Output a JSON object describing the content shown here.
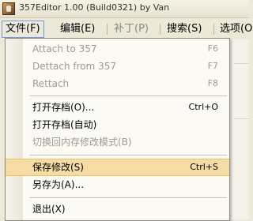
{
  "window": {
    "title": "357Editor 1.00 (Build0321) by Van"
  },
  "menubar": {
    "items": [
      {
        "label": "文件(F)",
        "state": "active"
      },
      {
        "label": "编辑(E)",
        "state": "normal"
      },
      {
        "label": "补丁(P)",
        "state": "disabled"
      },
      {
        "label": "搜索(S)",
        "state": "normal"
      },
      {
        "label": "选项(O)",
        "state": "normal"
      }
    ]
  },
  "file_menu": {
    "items": [
      {
        "label": "Attach to 357",
        "shortcut": "F6",
        "enabled": false
      },
      {
        "label": "Dettach from 357",
        "shortcut": "F7",
        "enabled": false
      },
      {
        "label": "Rettach",
        "shortcut": "F8",
        "enabled": false
      },
      {
        "label": "打开存档(O)...",
        "shortcut": "Ctrl+O",
        "enabled": true
      },
      {
        "label": "打开存档(自动)",
        "shortcut": "",
        "enabled": true
      },
      {
        "label": "切换回内存修改模式(B)",
        "shortcut": "",
        "enabled": false
      },
      {
        "label": "保存修改(S)",
        "shortcut": "Ctrl+S",
        "enabled": true,
        "highlighted": true
      },
      {
        "label": "另存为(A)...",
        "shortcut": "",
        "enabled": true
      },
      {
        "label": "退出(X)",
        "shortcut": "",
        "enabled": true
      }
    ]
  },
  "colors": {
    "menu_background": "#fbfaf4",
    "highlight": "#f6dca4",
    "disabled_text": "#9c9a90",
    "chrome": "#ece9d8"
  }
}
